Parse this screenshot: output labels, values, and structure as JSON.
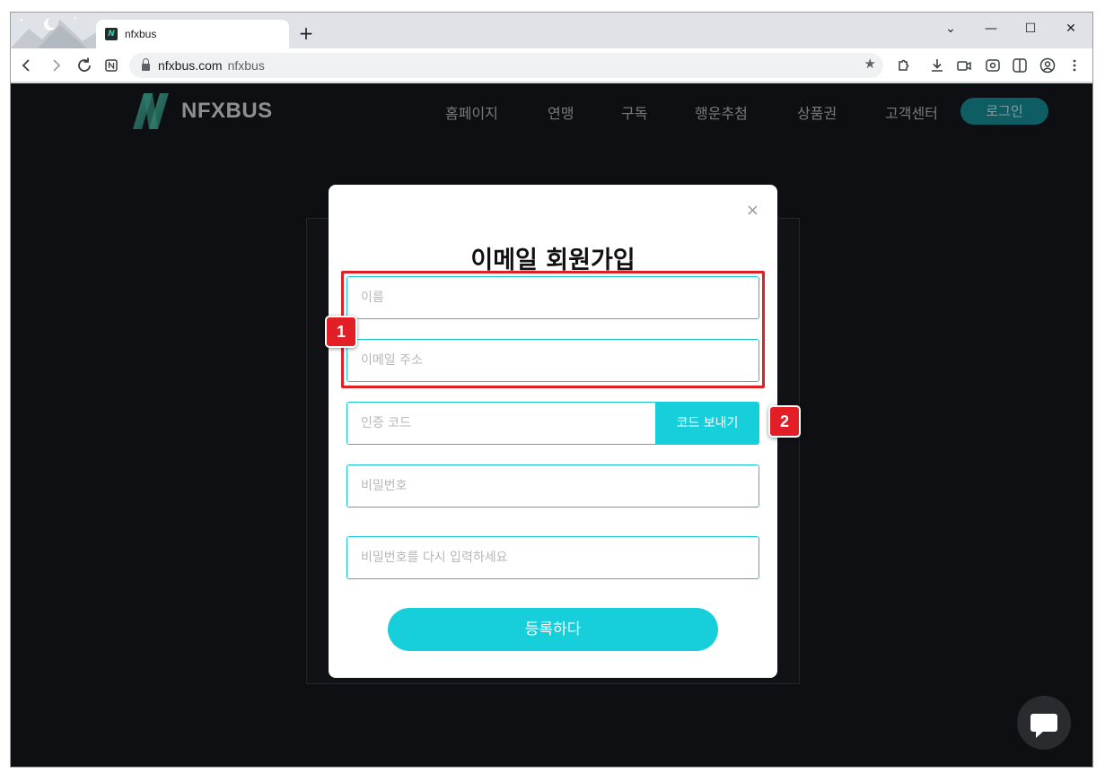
{
  "browser": {
    "tab_title": "nfxbus",
    "new_tab": "+",
    "url": "nfxbus.com",
    "url_title": "nfxbus",
    "win_min": "—",
    "win_max": "☐",
    "win_close": "✕",
    "tab_dropdown": "⌄"
  },
  "site": {
    "logo_text": "NFXBUS",
    "nav": [
      "홈페이지",
      "연맹",
      "구독",
      "행운추첨",
      "상품권",
      "고객센터"
    ],
    "login": "로그인"
  },
  "modal": {
    "close": "×",
    "title": "이메일 회원가입",
    "name_placeholder": "이름",
    "email_placeholder": "이메일 주소",
    "code_placeholder": "인증 코드",
    "send_code": "코드 보내기",
    "password_placeholder": "비밀번호",
    "password_confirm_placeholder": "비밀번호를 다시 입력하세요",
    "submit": "등록하다"
  },
  "annotations": {
    "badge1": "1",
    "badge2": "2",
    "color": "#e21f26"
  },
  "colors": {
    "accent": "#16cfdb",
    "page_bg": "#0e0f13",
    "login_bg": "#0e5d63"
  }
}
